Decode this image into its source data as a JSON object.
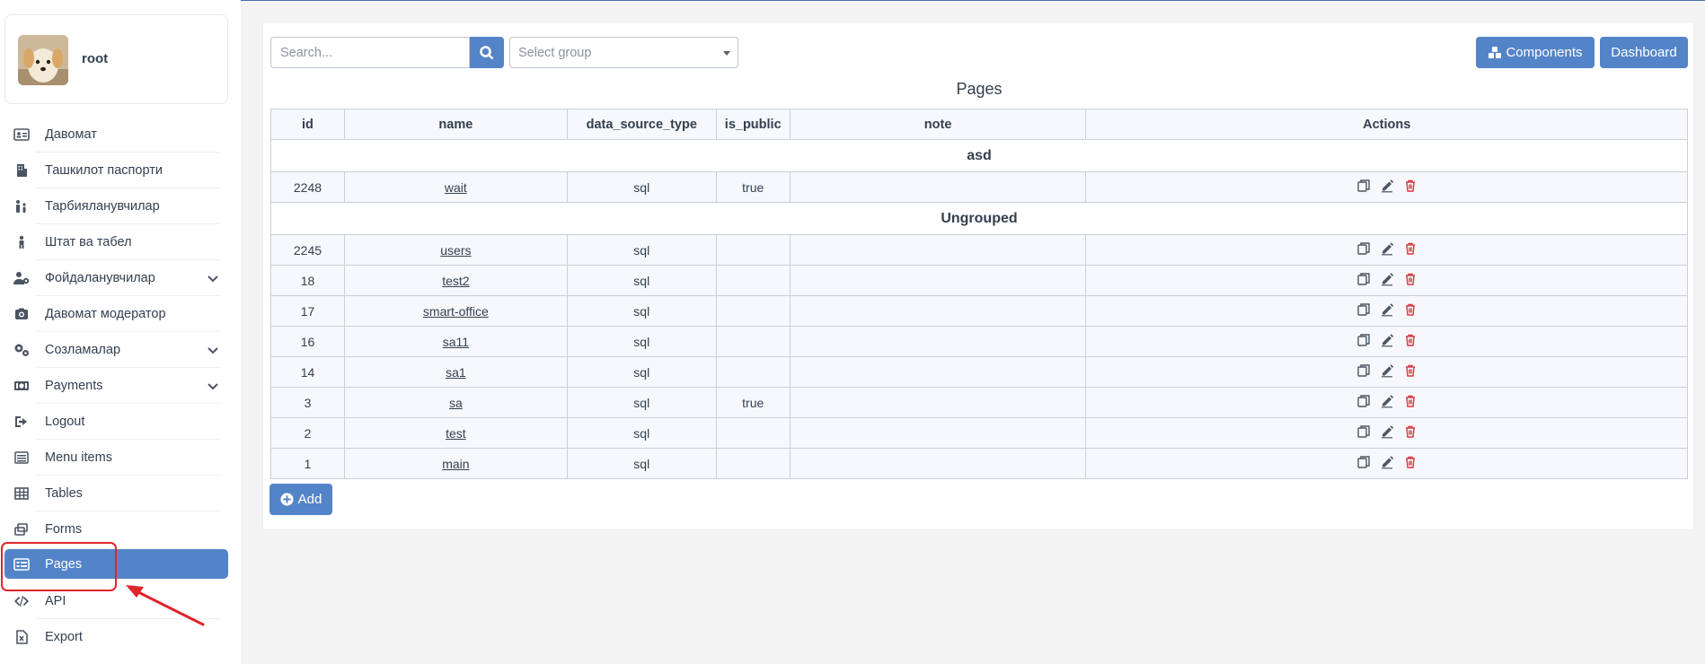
{
  "user": {
    "name": "root"
  },
  "sidebar": {
    "items": [
      {
        "label": "Давомат",
        "icon": "id-card-icon",
        "chevron": false
      },
      {
        "label": "Ташкилот паспорти",
        "icon": "building-icon",
        "chevron": false
      },
      {
        "label": "Тарбияланувчилар",
        "icon": "children-icon",
        "chevron": false
      },
      {
        "label": "Штат ва табел",
        "icon": "staff-icon",
        "chevron": false
      },
      {
        "label": "Фойдаланувчилар",
        "icon": "users-cog-icon",
        "chevron": true
      },
      {
        "label": "Давомат модератор",
        "icon": "camera-icon",
        "chevron": false
      },
      {
        "label": "Созламалар",
        "icon": "gears-icon",
        "chevron": true
      },
      {
        "label": "Payments",
        "icon": "money-icon",
        "chevron": true
      },
      {
        "label": "Logout",
        "icon": "logout-icon",
        "chevron": false
      },
      {
        "label": "Menu items",
        "icon": "list-icon",
        "chevron": false
      },
      {
        "label": "Tables",
        "icon": "table-icon",
        "chevron": false
      },
      {
        "label": "Forms",
        "icon": "forms-icon",
        "chevron": false
      },
      {
        "label": "Pages",
        "icon": "pages-icon",
        "chevron": false,
        "active": true
      },
      {
        "label": "API",
        "icon": "code-icon",
        "chevron": false
      },
      {
        "label": "Export",
        "icon": "export-file-icon",
        "chevron": false
      }
    ]
  },
  "toolbar": {
    "search_placeholder": "Search...",
    "select_placeholder": "Select group",
    "components_label": "Components",
    "dashboard_label": "Dashboard",
    "add_label": "Add"
  },
  "main": {
    "title": "Pages"
  },
  "table": {
    "columns": [
      "id",
      "name",
      "data_source_type",
      "is_public",
      "note",
      "Actions"
    ],
    "groups": [
      {
        "name": "asd",
        "rows": [
          {
            "id": "2248",
            "name": "wait",
            "data_source_type": "sql",
            "is_public": "true",
            "note": ""
          }
        ]
      },
      {
        "name": "Ungrouped",
        "rows": [
          {
            "id": "2245",
            "name": "users",
            "data_source_type": "sql",
            "is_public": "",
            "note": ""
          },
          {
            "id": "18",
            "name": "test2",
            "data_source_type": "sql",
            "is_public": "",
            "note": ""
          },
          {
            "id": "17",
            "name": "smart-office",
            "data_source_type": "sql",
            "is_public": "",
            "note": ""
          },
          {
            "id": "16",
            "name": "sa11",
            "data_source_type": "sql",
            "is_public": "",
            "note": ""
          },
          {
            "id": "14",
            "name": "sa1",
            "data_source_type": "sql",
            "is_public": "",
            "note": ""
          },
          {
            "id": "3",
            "name": "sa",
            "data_source_type": "sql",
            "is_public": "true",
            "note": ""
          },
          {
            "id": "2",
            "name": "test",
            "data_source_type": "sql",
            "is_public": "",
            "note": ""
          },
          {
            "id": "1",
            "name": "main",
            "data_source_type": "sql",
            "is_public": "",
            "note": ""
          }
        ]
      }
    ]
  },
  "colors": {
    "accent": "#5484c8",
    "delete": "#d9363e",
    "annotation": "#e0252b"
  }
}
